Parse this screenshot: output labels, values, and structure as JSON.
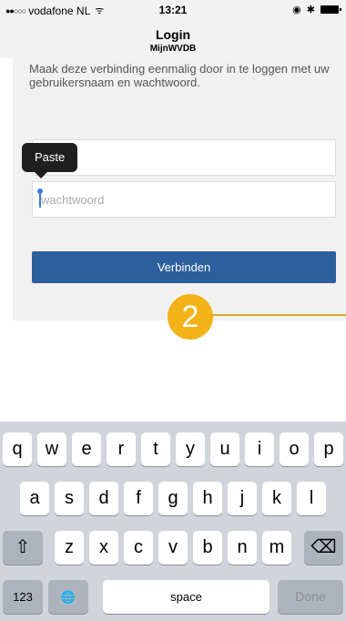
{
  "status_bar": {
    "signal": "●●○○○",
    "carrier": "vodafone NL",
    "wifi": "ᯤ",
    "time": "13:21",
    "alarm": "◉",
    "bluetooth": "✱"
  },
  "nav": {
    "title": "Login",
    "subtitle": "MijnWVDB"
  },
  "form": {
    "intro": "Maak deze verbinding eenmalig door in te loggen met uw gebruikersnaam en wachtwoord.",
    "password_placeholder": "wachtwoord",
    "submit_label": "Verbinden",
    "paste_label": "Paste"
  },
  "annotation": {
    "badge": "2"
  },
  "keyboard": {
    "row1": [
      "q",
      "w",
      "e",
      "r",
      "t",
      "y",
      "u",
      "i",
      "o",
      "p"
    ],
    "row2": [
      "a",
      "s",
      "d",
      "f",
      "g",
      "h",
      "j",
      "k",
      "l"
    ],
    "row3": [
      "z",
      "x",
      "c",
      "v",
      "b",
      "n",
      "m"
    ],
    "shift": "⇧",
    "backspace": "⌫",
    "numbers": "123",
    "globe": "🌐",
    "space": "space",
    "done": "Done"
  },
  "colors": {
    "primary": "#2d5f9e",
    "badge": "#f3b218"
  }
}
